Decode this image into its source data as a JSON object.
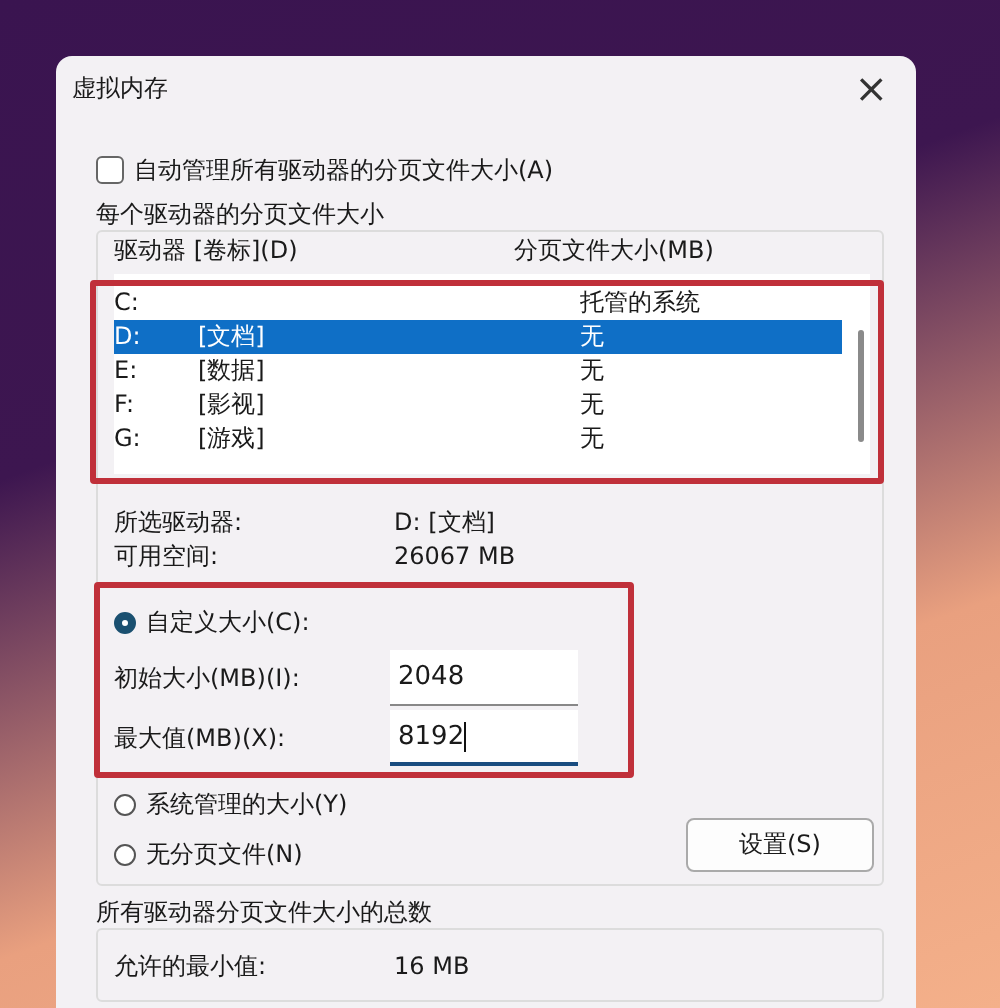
{
  "window": {
    "title": "虚拟内存",
    "close": "×"
  },
  "auto_manage": {
    "label": "自动管理所有驱动器的分页文件大小(A)",
    "checked": false
  },
  "per_drive": {
    "title": "每个驱动器的分页文件大小",
    "columns": [
      "驱动器 [卷标](D)",
      "分页文件大小(MB)"
    ],
    "drives": [
      {
        "drive": "C:",
        "size": "托管的系统",
        "selected": false
      },
      {
        "drive": "D:",
        "label": "[文档]",
        "size": "无",
        "selected": true
      },
      {
        "drive": "E:",
        "label": "[数据]",
        "size": "无",
        "selected": false
      },
      {
        "drive": "F:",
        "label": "[影视]",
        "size": "无",
        "selected": false
      },
      {
        "drive": "G:",
        "label": "[游戏]",
        "size": "无",
        "selected": false
      }
    ],
    "info": [
      {
        "label": "所选驱动器:",
        "value": "D:  [文档]"
      },
      {
        "label": "可用空间:",
        "value": "26067 MB"
      }
    ],
    "options": [
      {
        "kind": "radio",
        "label": "自定义大小(C):",
        "selected": true
      },
      {
        "kind": "field",
        "label": "初始大小(MB)(I):",
        "value": "2048",
        "focused": false
      },
      {
        "kind": "field",
        "label": "最大值(MB)(X):",
        "value": "8192",
        "focused": true
      },
      {
        "kind": "radio",
        "label": "系统管理的大小(Y)",
        "selected": false
      },
      {
        "kind": "radio",
        "label": "无分页文件(N)",
        "selected": false
      }
    ],
    "set_button": "设置(S)"
  },
  "totals": {
    "title": "所有驱动器分页文件大小的总数",
    "rows": [
      {
        "label": "允许的最小值:",
        "value": "16 MB"
      }
    ]
  }
}
